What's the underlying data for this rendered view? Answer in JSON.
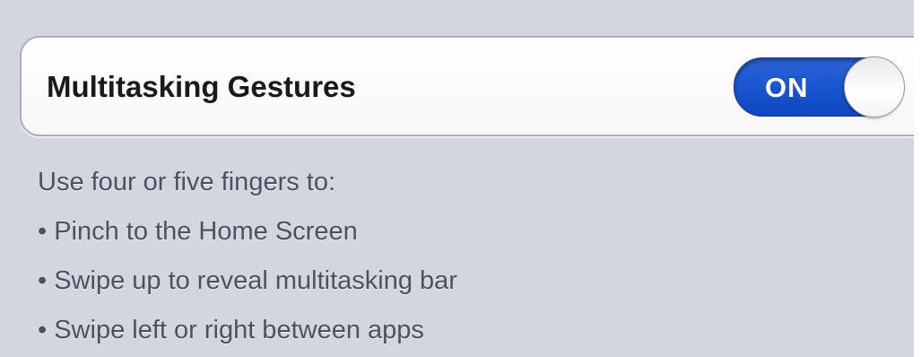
{
  "setting": {
    "label": "Multitasking Gestures",
    "toggle": {
      "state_text": "ON",
      "checked": true
    }
  },
  "description": {
    "intro": "Use four or five fingers to:",
    "items": [
      "• Pinch to the Home Screen",
      "• Swipe up to reveal multitasking bar",
      "• Swipe left or right between apps"
    ]
  },
  "colors": {
    "background": "#d3d6de",
    "toggle_on": "#1a55d0",
    "label_text": "#1a1a1a",
    "footer_text": "#4a5161"
  }
}
